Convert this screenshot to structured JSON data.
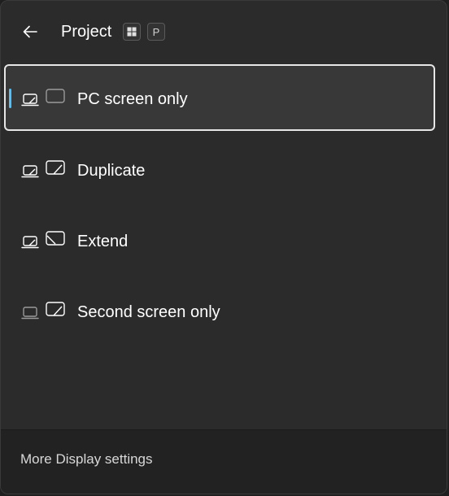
{
  "header": {
    "title": "Project",
    "back_icon": "arrow-left-icon",
    "shortcut_keys": [
      "windows-key",
      "P"
    ]
  },
  "options": [
    {
      "label": "PC screen only",
      "icon": "pc-screen-only-icon",
      "selected": true
    },
    {
      "label": "Duplicate",
      "icon": "duplicate-icon",
      "selected": false
    },
    {
      "label": "Extend",
      "icon": "extend-icon",
      "selected": false
    },
    {
      "label": "Second screen only",
      "icon": "second-screen-only-icon",
      "selected": false
    }
  ],
  "footer": {
    "link_label": "More Display settings"
  },
  "colors": {
    "accent": "#4cc2ff",
    "panel_bg": "#2b2b2b",
    "footer_bg": "#222222"
  }
}
